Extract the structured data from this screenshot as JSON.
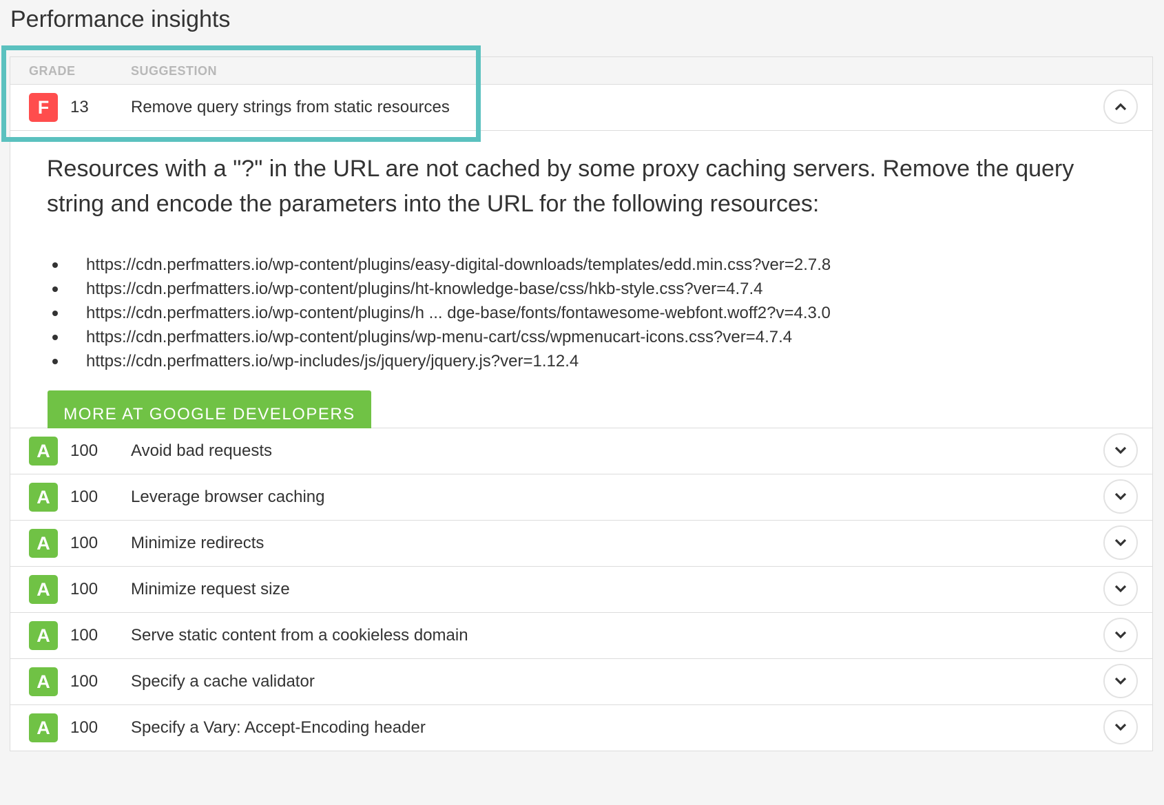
{
  "page": {
    "title": "Performance insights"
  },
  "colors": {
    "grade_f": "#ff4d4d",
    "grade_a": "#70c245",
    "highlight": "#5bc1bf",
    "button": "#70c245"
  },
  "table": {
    "headers": {
      "grade": "GRADE",
      "suggestion": "SUGGESTION"
    },
    "expanded": {
      "grade": "F",
      "score": "13",
      "suggestion": "Remove query strings from static resources",
      "toggle_icon": "chevron-up-icon",
      "description": "Resources with a \"?\" in the URL are not cached by some proxy caching servers. Remove the query string and encode the parameters into the URL for the following resources:",
      "resources": [
        "https://cdn.perfmatters.io/wp-content/plugins/easy-digital-downloads/templates/edd.min.css?ver=2.7.8",
        "https://cdn.perfmatters.io/wp-content/plugins/ht-knowledge-base/css/hkb-style.css?ver=4.7.4",
        "https://cdn.perfmatters.io/wp-content/plugins/h ... dge-base/fonts/fontawesome-webfont.woff2?v=4.3.0",
        "https://cdn.perfmatters.io/wp-content/plugins/wp-menu-cart/css/wpmenucart-icons.css?ver=4.7.4",
        "https://cdn.perfmatters.io/wp-includes/js/jquery/jquery.js?ver=1.12.4"
      ],
      "more_button": "MORE AT GOOGLE DEVELOPERS"
    },
    "rows": [
      {
        "grade": "A",
        "score": "100",
        "suggestion": "Avoid bad requests",
        "toggle_icon": "chevron-down-icon"
      },
      {
        "grade": "A",
        "score": "100",
        "suggestion": "Leverage browser caching",
        "toggle_icon": "chevron-down-icon"
      },
      {
        "grade": "A",
        "score": "100",
        "suggestion": "Minimize redirects",
        "toggle_icon": "chevron-down-icon"
      },
      {
        "grade": "A",
        "score": "100",
        "suggestion": "Minimize request size",
        "toggle_icon": "chevron-down-icon"
      },
      {
        "grade": "A",
        "score": "100",
        "suggestion": "Serve static content from a cookieless domain",
        "toggle_icon": "chevron-down-icon"
      },
      {
        "grade": "A",
        "score": "100",
        "suggestion": "Specify a cache validator",
        "toggle_icon": "chevron-down-icon"
      },
      {
        "grade": "A",
        "score": "100",
        "suggestion": "Specify a Vary: Accept-Encoding header",
        "toggle_icon": "chevron-down-icon"
      }
    ]
  }
}
